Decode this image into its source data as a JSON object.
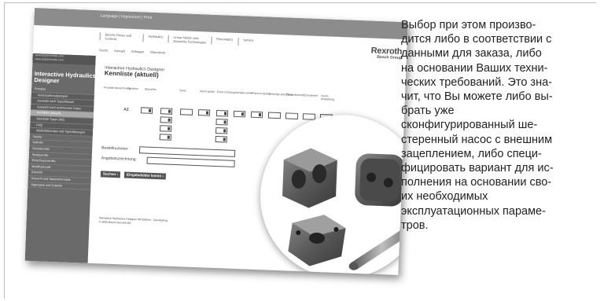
{
  "screenshot": {
    "top_strip_links": "Language | Impressum | Print",
    "top_nav": [
      "Electric Drives and Controls",
      "Hydraulics",
      "Linear Motion and Assembly Technologies",
      "Pneumatics",
      "Service"
    ],
    "brand": {
      "name": "Rexroth",
      "group": "Bosch Group"
    },
    "toolbar": [
      "Suche",
      "Kontakt",
      "Anfragen",
      "Warenkorb"
    ],
    "sidebar": {
      "urls": [
        "www.boschrexroth.com",
        "www.boschrexroth.com"
      ],
      "title_line1": "Interactive Hydraulics",
      "title_line2": "Designer",
      "menu": [
        {
          "label": "Pumpen",
          "level": 0,
          "highlight": false
        },
        {
          "label": "Außenzahnradpumpen",
          "level": 1,
          "highlight": false
        },
        {
          "label": "Auswahl nach Typschlüssel",
          "level": 1,
          "highlight": false
        },
        {
          "label": "Auswahl nach technischen Daten",
          "level": 1,
          "highlight": false
        },
        {
          "label": "Kennliste (aktuell)",
          "level": 1,
          "highlight": true
        },
        {
          "label": "Kennliste Typen (AE)",
          "level": 1,
          "highlight": false
        },
        {
          "label": "FAQ",
          "level": 1,
          "highlight": false
        },
        {
          "label": "Weiterführendes und Typenleitungen",
          "level": 1,
          "highlight": false
        },
        {
          "label": "Ventile",
          "level": 0,
          "highlight": false
        },
        {
          "label": "Zylinder",
          "level": 0,
          "highlight": false
        },
        {
          "label": "Schaltventile",
          "level": 0,
          "highlight": false
        },
        {
          "label": "Stetigventile",
          "level": 0,
          "highlight": false
        },
        {
          "label": "Einschraubventile",
          "level": 0,
          "highlight": false
        },
        {
          "label": "Mobilhydraulik",
          "level": 0,
          "highlight": false
        },
        {
          "label": "Zubehör",
          "level": 0,
          "highlight": false
        },
        {
          "label": "Gesucht und Speichermodule",
          "level": 0,
          "highlight": false
        },
        {
          "label": "Aggregate und Zubehör",
          "level": 0,
          "highlight": false
        }
      ]
    },
    "main": {
      "title": "Interactive Hydraulics Designer",
      "subtitle": "Kennliste (aktuell)",
      "columns": [
        "Produkt-bezeichnung",
        "Funktion",
        "Baureihe",
        "Serie",
        "Nenn-größe",
        "Dreh-richtung",
        "Antriebs-welle",
        "Flansch-deckel",
        "Leitungs-anschluss",
        "Dicht-element",
        "End-deckel",
        "Ventil-einstellung"
      ],
      "row_code": "AZ",
      "field1_label": "Bestellnummer",
      "field2_label": "Angebotszeichnung",
      "button1": "Suchen ›",
      "button2": "Eingabefelder leeren ›",
      "footer_line1": "Interactive Hydraulics Designer 4th Edition - Zaunkoenig",
      "footer_line2": "© 2005 Bosch Rexroth AG"
    }
  },
  "body_text": [
    "Выбор при этом произво-",
    "дится либо в соответствии с",
    "данными для заказа, либо",
    "на основании Ваших техни-",
    "ческих требований. Это зна-",
    "чит, что Вы можете либо вы-",
    "брать уже",
    "сконфигурированный ше-",
    "стеренный насос с внешним",
    "зацеплением, либо специ-",
    "фицировать вариант для ис-",
    "полнения на основании сво-",
    "их необходимых",
    "эксплуатационных параме-",
    "тров."
  ]
}
